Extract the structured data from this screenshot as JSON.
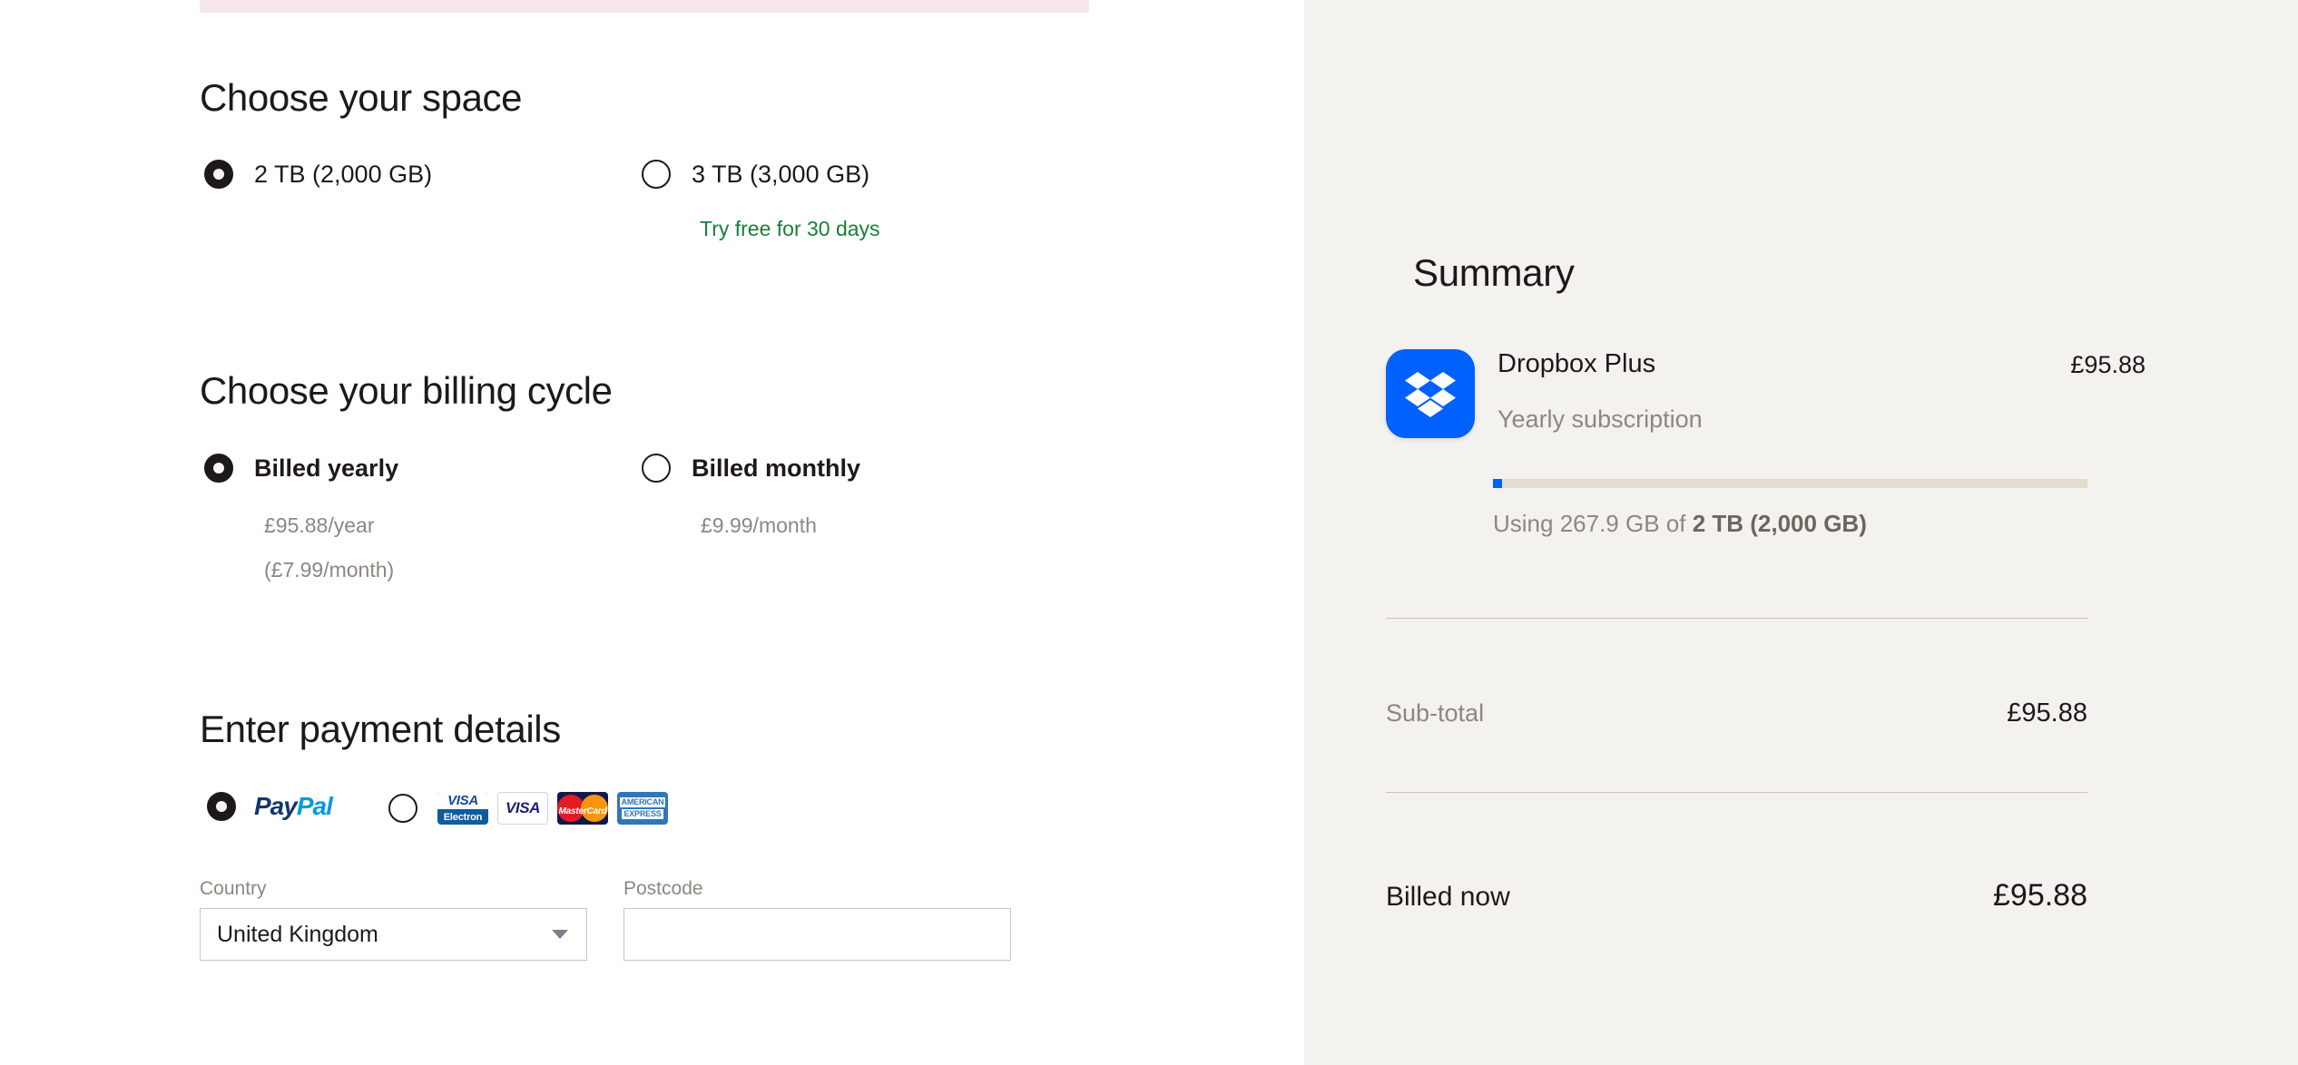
{
  "colors": {
    "progress_pink": "#f6e7ed",
    "panel_bg": "#f4f2ee",
    "dropbox_blue": "#0061ff",
    "trial_green": "#1a7f37",
    "muted_text": "#8c8781",
    "usage_track": "#e4dccd"
  },
  "space_section": {
    "title": "Choose your space",
    "options": [
      {
        "label": "2 TB (2,000 GB)",
        "selected": true,
        "note": ""
      },
      {
        "label": "3 TB (3,000 GB)",
        "selected": false,
        "note": "Try free for 30 days"
      }
    ]
  },
  "billing_section": {
    "title": "Choose your billing cycle",
    "options": [
      {
        "label": "Billed yearly",
        "selected": true,
        "price": "£95.88/year",
        "price2": "(£7.99/month)"
      },
      {
        "label": "Billed monthly",
        "selected": false,
        "price": "£9.99/month",
        "price2": ""
      }
    ]
  },
  "payment_section": {
    "title": "Enter payment details",
    "methods": [
      {
        "id": "paypal",
        "selected": true,
        "logo_part1": "Pay",
        "logo_part2": "Pal"
      },
      {
        "id": "card",
        "selected": false
      }
    ],
    "cards": [
      {
        "id": "visa-electron",
        "line1": "VISA",
        "line2": "Electron"
      },
      {
        "id": "visa",
        "line1": "VISA",
        "line2": ""
      },
      {
        "id": "mastercard",
        "line1": "MasterCard",
        "line2": ""
      },
      {
        "id": "amex",
        "line1": "AMERICAN",
        "line2": "EXPRESS"
      }
    ],
    "country": {
      "label": "Country",
      "value": "United Kingdom"
    },
    "postcode": {
      "label": "Postcode",
      "value": "",
      "placeholder": ""
    }
  },
  "summary": {
    "title": "Summary",
    "plan_name": "Dropbox Plus",
    "plan_price": "£95.88",
    "plan_subtitle": "Yearly subscription",
    "usage_text_prefix": "Using 267.9 GB of ",
    "usage_text_bold": "2 TB (2,000 GB)",
    "usage_percent": "1.5",
    "rows": [
      {
        "label": "Sub-total",
        "value": "£95.88",
        "total": false
      },
      {
        "label": "Billed now",
        "value": "£95.88",
        "total": true
      }
    ]
  }
}
